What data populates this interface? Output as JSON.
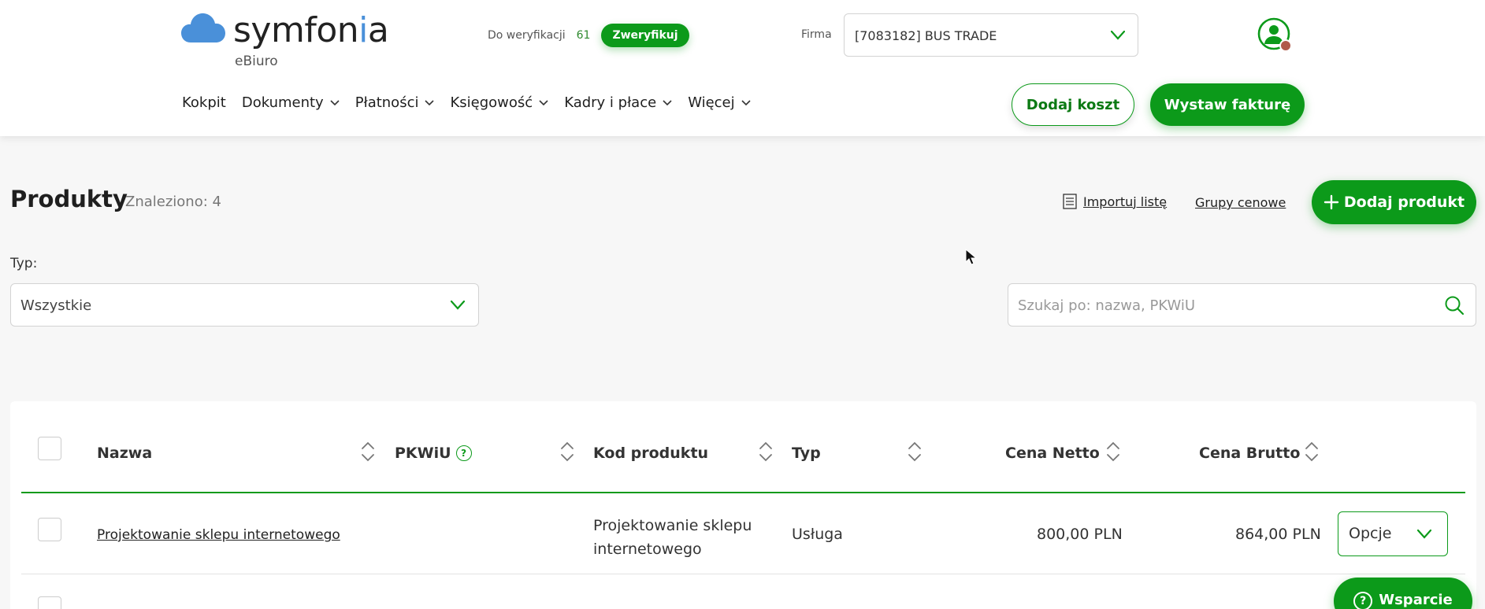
{
  "brand": {
    "name_left": "symfon",
    "name_dot": "i",
    "name_right": "a",
    "sub": "eBiuro",
    "accent": "#0c9a1a",
    "cloud_color": "#4a90d9"
  },
  "verification": {
    "label": "Do weryfikacji",
    "count": "61",
    "button": "Zweryfikuj"
  },
  "company": {
    "label": "Firma",
    "value": "[7083182] BUS TRADE"
  },
  "nav": [
    {
      "label": "Kokpit",
      "has_menu": false
    },
    {
      "label": "Dokumenty",
      "has_menu": true
    },
    {
      "label": "Płatności",
      "has_menu": true
    },
    {
      "label": "Księgowość",
      "has_menu": true
    },
    {
      "label": "Kadry i płace",
      "has_menu": true
    },
    {
      "label": "Więcej",
      "has_menu": true
    }
  ],
  "actions": {
    "add_cost": "Dodaj koszt",
    "issue_invoice": "Wystaw fakturę"
  },
  "page": {
    "title": "Produkty",
    "found": "Znaleziono: 4",
    "import_list": "Importuj listę",
    "price_groups": "Grupy cenowe",
    "add_product": "Dodaj produkt"
  },
  "filters": {
    "type_label": "Typ:",
    "type_value": "Wszystkie",
    "search_placeholder": "Szukaj po: nazwa, PKWiU"
  },
  "table": {
    "columns": [
      "Nazwa",
      "PKWiU",
      "Kod produktu",
      "Typ",
      "Cena Netto",
      "Cena Brutto"
    ],
    "pkwiu_help": "?",
    "rows": [
      {
        "name": "Projektowanie sklepu internetowego",
        "pkwiu": "",
        "code_line1": "Projektowanie sklepu",
        "code_line2": "internetowego",
        "type": "Usługa",
        "net": "800,00 PLN",
        "gross": "864,00 PLN",
        "options": "Opcje"
      }
    ]
  },
  "support": {
    "label": "Wsparcie",
    "icon": "?"
  }
}
